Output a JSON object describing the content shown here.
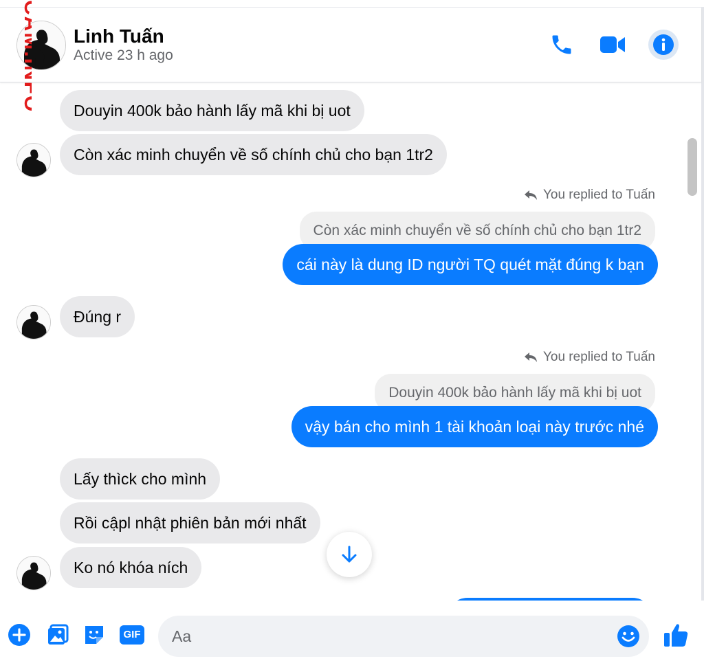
{
  "header": {
    "name": "Linh Tuấn",
    "status": "Active 23 h ago",
    "watermark": "CAM.INFO"
  },
  "colors": {
    "accent": "#0a7cff",
    "incoming_bubble": "#e9e9eb",
    "muted_text": "#65676b"
  },
  "messages": [
    {
      "direction": "in",
      "text": "Douyin 400k bảo hành lấy mã khi bị uot"
    },
    {
      "direction": "in",
      "text": "Còn xác minh chuyển về số chính chủ cho bạn 1tr2"
    },
    {
      "direction": "out",
      "reply_label": "You replied to Tuấn",
      "quote": "Còn xác minh chuyển về số chính chủ cho bạn 1tr2",
      "text": "cái này là dung ID người TQ quét mặt đúng k bạn"
    },
    {
      "direction": "in",
      "text": "Đúng r"
    },
    {
      "direction": "out",
      "reply_label": "You replied to Tuấn",
      "quote": "Douyin 400k bảo hành lấy mã khi bị uot",
      "text": "vậy bán cho mình 1 tài khoản loại này trước nhé"
    },
    {
      "direction": "in",
      "text": "Lấy thìck cho mình"
    },
    {
      "direction": "in",
      "text": "Rồi cậpl nhật phiên bản mới nhất"
    },
    {
      "direction": "in",
      "text": "Ko nó khóa ních"
    }
  ],
  "composer": {
    "placeholder": "Aa",
    "gif_label": "GIF",
    "icons": [
      "add-icon",
      "photo-icon",
      "sticker-icon",
      "gif-icon",
      "emoji-icon",
      "thumbs-up-icon"
    ]
  },
  "header_icons": [
    "phone-icon",
    "video-camera-icon",
    "info-icon"
  ]
}
